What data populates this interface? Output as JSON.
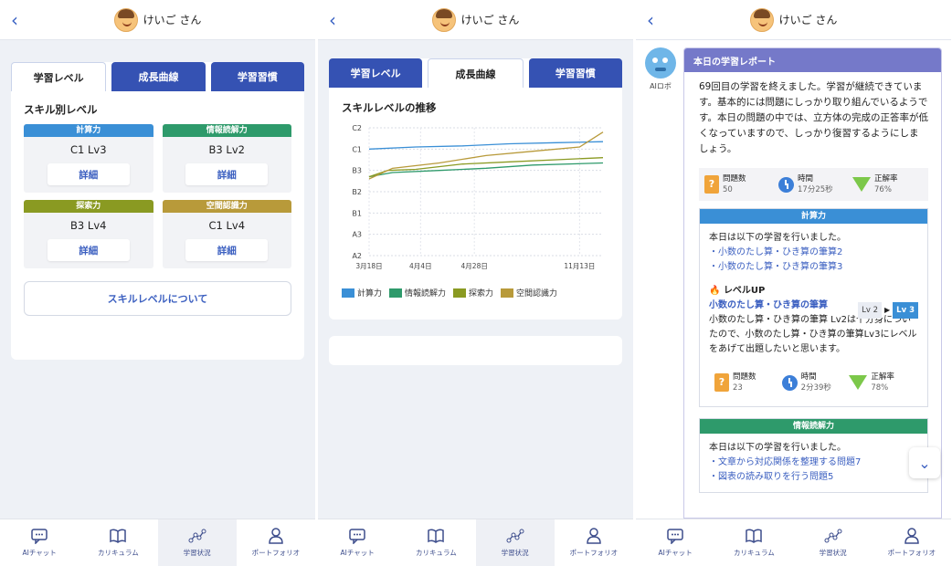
{
  "user_name": "けいご さん",
  "tabs": [
    "学習レベル",
    "成長曲線",
    "学習習慣"
  ],
  "nav": [
    "AIチャット",
    "カリキュラム",
    "学習状況",
    "ポートフォリオ"
  ],
  "screen1": {
    "section_title": "スキル別レベル",
    "skills": [
      {
        "name": "計算力",
        "level": "C1 Lv3",
        "color": "#3a8fd6"
      },
      {
        "name": "情報読解力",
        "level": "B3 Lv2",
        "color": "#2e9a6b"
      },
      {
        "name": "探索力",
        "level": "B3 Lv4",
        "color": "#8a9a22"
      },
      {
        "name": "空間認識力",
        "level": "C1 Lv4",
        "color": "#b89a3a"
      }
    ],
    "detail_label": "詳細",
    "about_button": "スキルレベルについて"
  },
  "screen2": {
    "chart_title": "スキルレベルの推移"
  },
  "chart_data": {
    "type": "line",
    "title": "スキルレベルの推移",
    "y_ticks": [
      "C2",
      "C1",
      "B3",
      "B2",
      "B1",
      "A3",
      "A2"
    ],
    "x_ticks": [
      "3月18日",
      "4月4日",
      "4月28日",
      "11月13日"
    ],
    "grid": true,
    "legend_position": "bottom",
    "series": [
      {
        "name": "計算力",
        "color": "#3a8fd6",
        "x": [
          0,
          0.2,
          0.4,
          0.6,
          0.8,
          1.0
        ],
        "y": [
          5.0,
          5.1,
          5.15,
          5.25,
          5.3,
          5.35
        ]
      },
      {
        "name": "情報読解力",
        "color": "#2e9a6b",
        "x": [
          0,
          0.1,
          0.3,
          0.5,
          0.7,
          1.0
        ],
        "y": [
          3.7,
          3.9,
          4.0,
          4.1,
          4.25,
          4.35
        ]
      },
      {
        "name": "探索力",
        "color": "#8a9a22",
        "x": [
          0,
          0.08,
          0.2,
          0.4,
          0.6,
          0.8,
          1.0
        ],
        "y": [
          3.7,
          4.0,
          4.05,
          4.3,
          4.4,
          4.5,
          4.6
        ]
      },
      {
        "name": "空間認識力",
        "color": "#b89a3a",
        "x": [
          0,
          0.1,
          0.3,
          0.5,
          0.7,
          0.9,
          1.0
        ],
        "y": [
          3.6,
          4.1,
          4.35,
          4.7,
          4.9,
          5.1,
          5.8
        ]
      }
    ]
  },
  "screen3": {
    "bot_label": "AIロボ",
    "report_title": "本日の学習レポート",
    "report_text": "69回目の学習を終えました。学習が継続できています。基本的には問題にしっかり取り組んでいるようです。本日の問題の中では、立方体の完成の正答率が低くなっていますので、しっかり復習するようにしましょう。",
    "stats": [
      {
        "label": "問題数",
        "value": "50"
      },
      {
        "label": "時間",
        "value": "17分25秒"
      },
      {
        "label": "正解率",
        "value": "76%"
      }
    ],
    "subjects": [
      {
        "name": "計算力",
        "color": "#3a8fd6",
        "intro": "本日は以下の学習を行いました。",
        "links": [
          "・小数のたし算・ひき算の筆算2",
          "・小数のたし算・ひき算の筆算3"
        ],
        "levelup_title": "レベルUP",
        "levelup_link": "小数のたし算・ひき算の筆算",
        "lv_from": "Lv 2",
        "lv_to": "Lv 3",
        "levelup_text": "小数のたし算・ひき算の筆算 Lv2は十分身についたので、小数のたし算・ひき算の筆算Lv3にレベルをあげて出題したいと思います。",
        "stats": [
          {
            "label": "問題数",
            "value": "23"
          },
          {
            "label": "時間",
            "value": "2分39秒"
          },
          {
            "label": "正解率",
            "value": "78%"
          }
        ]
      },
      {
        "name": "情報読解力",
        "color": "#2e9a6b",
        "intro": "本日は以下の学習を行いました。",
        "links": [
          "・文章から対応関係を整理する問題7",
          "・図表の読み取りを行う問題5"
        ]
      }
    ]
  }
}
